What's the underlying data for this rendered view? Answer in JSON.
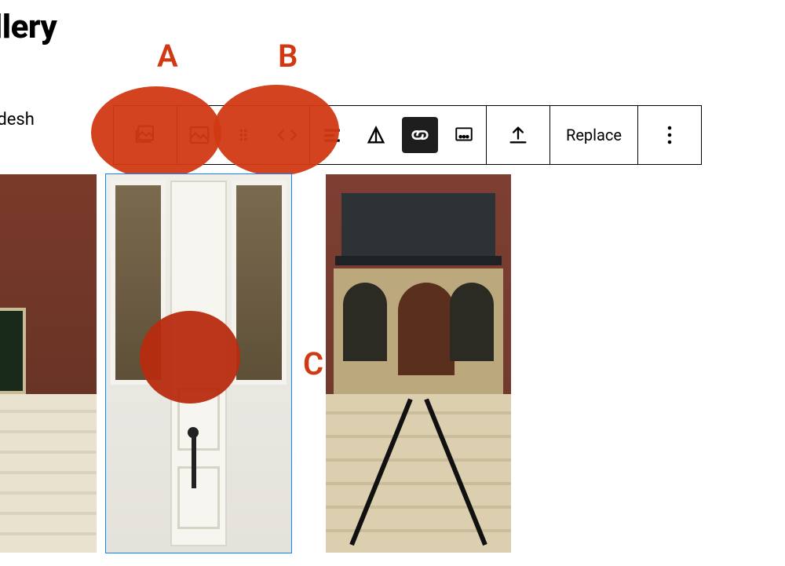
{
  "page": {
    "heading": "allery",
    "subtext": "en slidesh"
  },
  "toolbar": {
    "gallery_icon": "gallery-icon",
    "image_icon": "image-icon",
    "drag_icon": "drag-handle-icon",
    "move_icon": "move-arrows-icon",
    "align_icon": "align-icon",
    "change_icon": "change-alignment-icon",
    "link_icon": "link-icon",
    "caption_icon": "caption-icon",
    "upload_icon": "upload-icon",
    "replace_label": "Replace",
    "more_icon": "more-options-icon"
  },
  "annotations": {
    "a": "A",
    "b": "B",
    "c": "C"
  },
  "gallery": {
    "selected_index": 1,
    "items": [
      {
        "alt": "brick building with stairs"
      },
      {
        "alt": "white double door close-up"
      },
      {
        "alt": "brownstone entrance with stairs"
      }
    ]
  },
  "colors": {
    "annotation": "#d13913",
    "selection": "#0a84ff",
    "link_bg": "#1e1e1e"
  }
}
